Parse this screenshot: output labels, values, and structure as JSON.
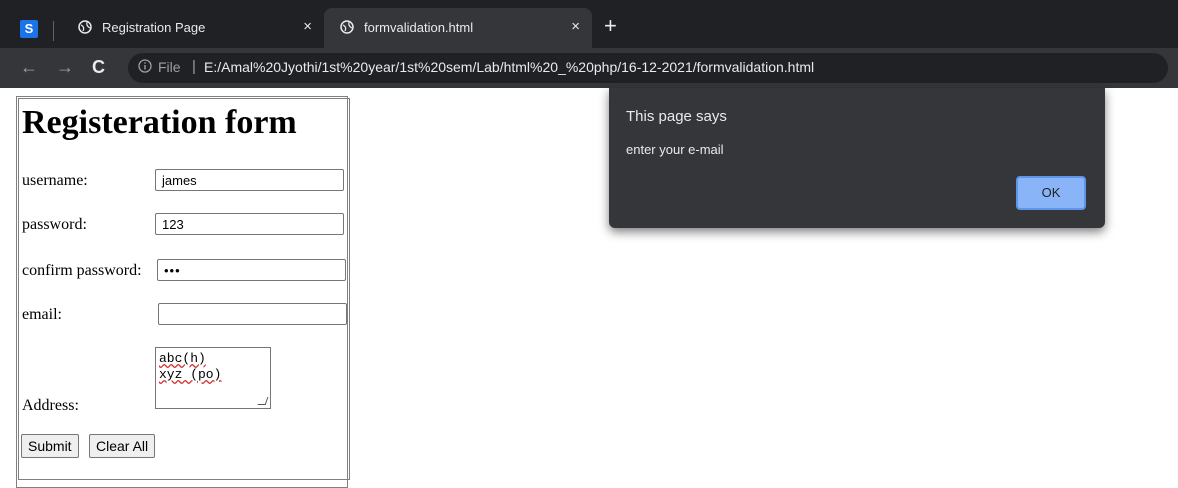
{
  "browser": {
    "app_icon": "S",
    "tabs": [
      {
        "title": "Registration Page",
        "active": false
      },
      {
        "title": "formvalidation.html",
        "active": true
      }
    ],
    "new_tab_symbol": "+",
    "close_symbol": "×",
    "address": {
      "scheme_label": "File",
      "separator": "|",
      "url": "E:/Amal%20Jyothi/1st%20year/1st%20sem/Lab/html%20_%20php/16-12-2021/formvalidation.html"
    },
    "icons": {
      "back": "back-arrow-icon",
      "forward": "forward-arrow-icon",
      "reload": "reload-icon",
      "info": "info-icon",
      "globe": "globe-icon"
    },
    "colors": {
      "chrome_dark": "#202124",
      "toolbar": "#35363a",
      "text_light": "#e8eaed"
    }
  },
  "form": {
    "heading": "Registeration form",
    "username": {
      "label": "username:",
      "value": "james"
    },
    "password": {
      "label": "password:",
      "value": "123"
    },
    "confirm_password": {
      "label": "confirm password:",
      "value": "•••"
    },
    "email": {
      "label": "email:",
      "value": ""
    },
    "address": {
      "label": "Address:",
      "lines": [
        "abc(h)",
        "xyz (po)"
      ]
    },
    "submit_label": "Submit",
    "clear_label": "Clear All"
  },
  "dialog": {
    "title": "This page says",
    "message": "enter your e-mail",
    "ok_label": "OK",
    "accent": "#8ab4f8"
  }
}
